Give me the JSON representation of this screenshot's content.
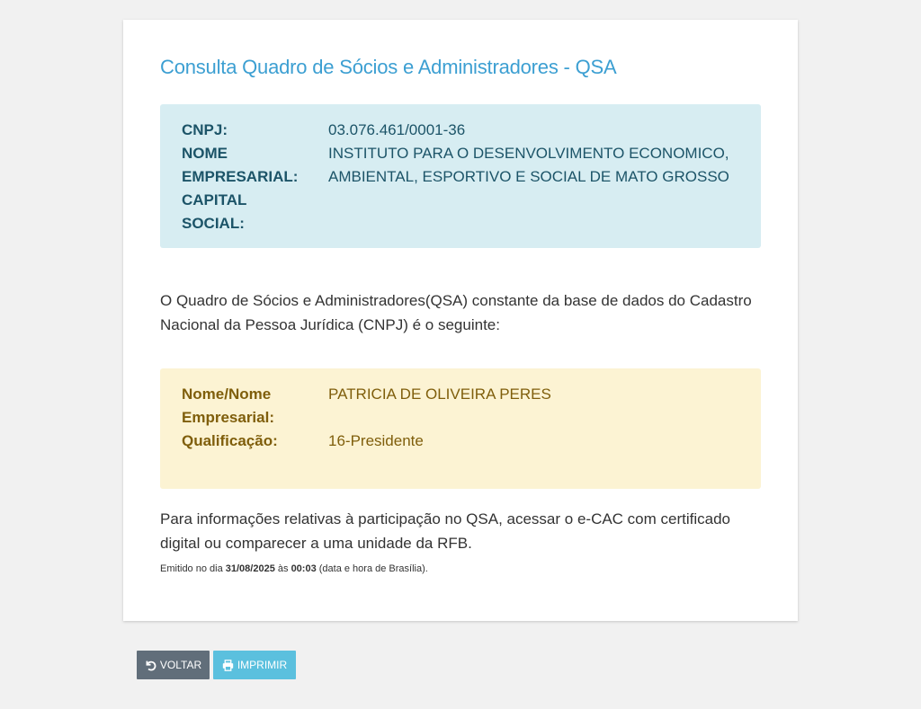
{
  "page": {
    "title": "Consulta Quadro de Sócios e Administradores - QSA"
  },
  "company": {
    "cnpj_label": "CNPJ:",
    "cnpj_value": "03.076.461/0001-36",
    "name_label_1": "NOME",
    "name_label_2": "EMPRESARIAL:",
    "name_value_1": "INSTITUTO PARA O DESENVOLVIMENTO ECONOMICO,",
    "name_value_2": "AMBIENTAL, ESPORTIVO E SOCIAL DE MATO GROSSO",
    "capital_label_1": "CAPITAL",
    "capital_label_2": "SOCIAL:",
    "capital_value": ""
  },
  "intro": {
    "line1": "O Quadro de Sócios e Administradores(QSA) constante da base de dados do Cadastro",
    "line2": "Nacional da Pessoa Jurídica (CNPJ) é o seguinte:"
  },
  "partner": {
    "name_label_1": "Nome/Nome",
    "name_label_2": "Empresarial:",
    "name_value": "PATRICIA DE OLIVEIRA PERES",
    "qual_label": "Qualificação:",
    "qual_value": "16-Presidente"
  },
  "footer_note": {
    "line1": "Para informações relativas à participação no QSA, acessar o e-CAC com certificado",
    "line2": "digital ou comparecer a uma unidade da RFB."
  },
  "emission": {
    "prefix": "Emitido no dia ",
    "date": "31/08/2025",
    "mid": " às ",
    "time": "00:03",
    "suffix": " (data e hora de Brasília)."
  },
  "buttons": {
    "back_label": "VOLTAR",
    "back_icon": "undo-icon",
    "print_label": "IMPRIMIR",
    "print_icon": "printer-icon"
  },
  "colors": {
    "title": "#3c9fd2",
    "info_bg": "#d7edf2",
    "info_text": "#1c5468",
    "partner_bg": "#fcf3d3",
    "partner_text": "#7f5e0b",
    "back_button": "#616e7a",
    "print_button": "#5bc0de"
  }
}
